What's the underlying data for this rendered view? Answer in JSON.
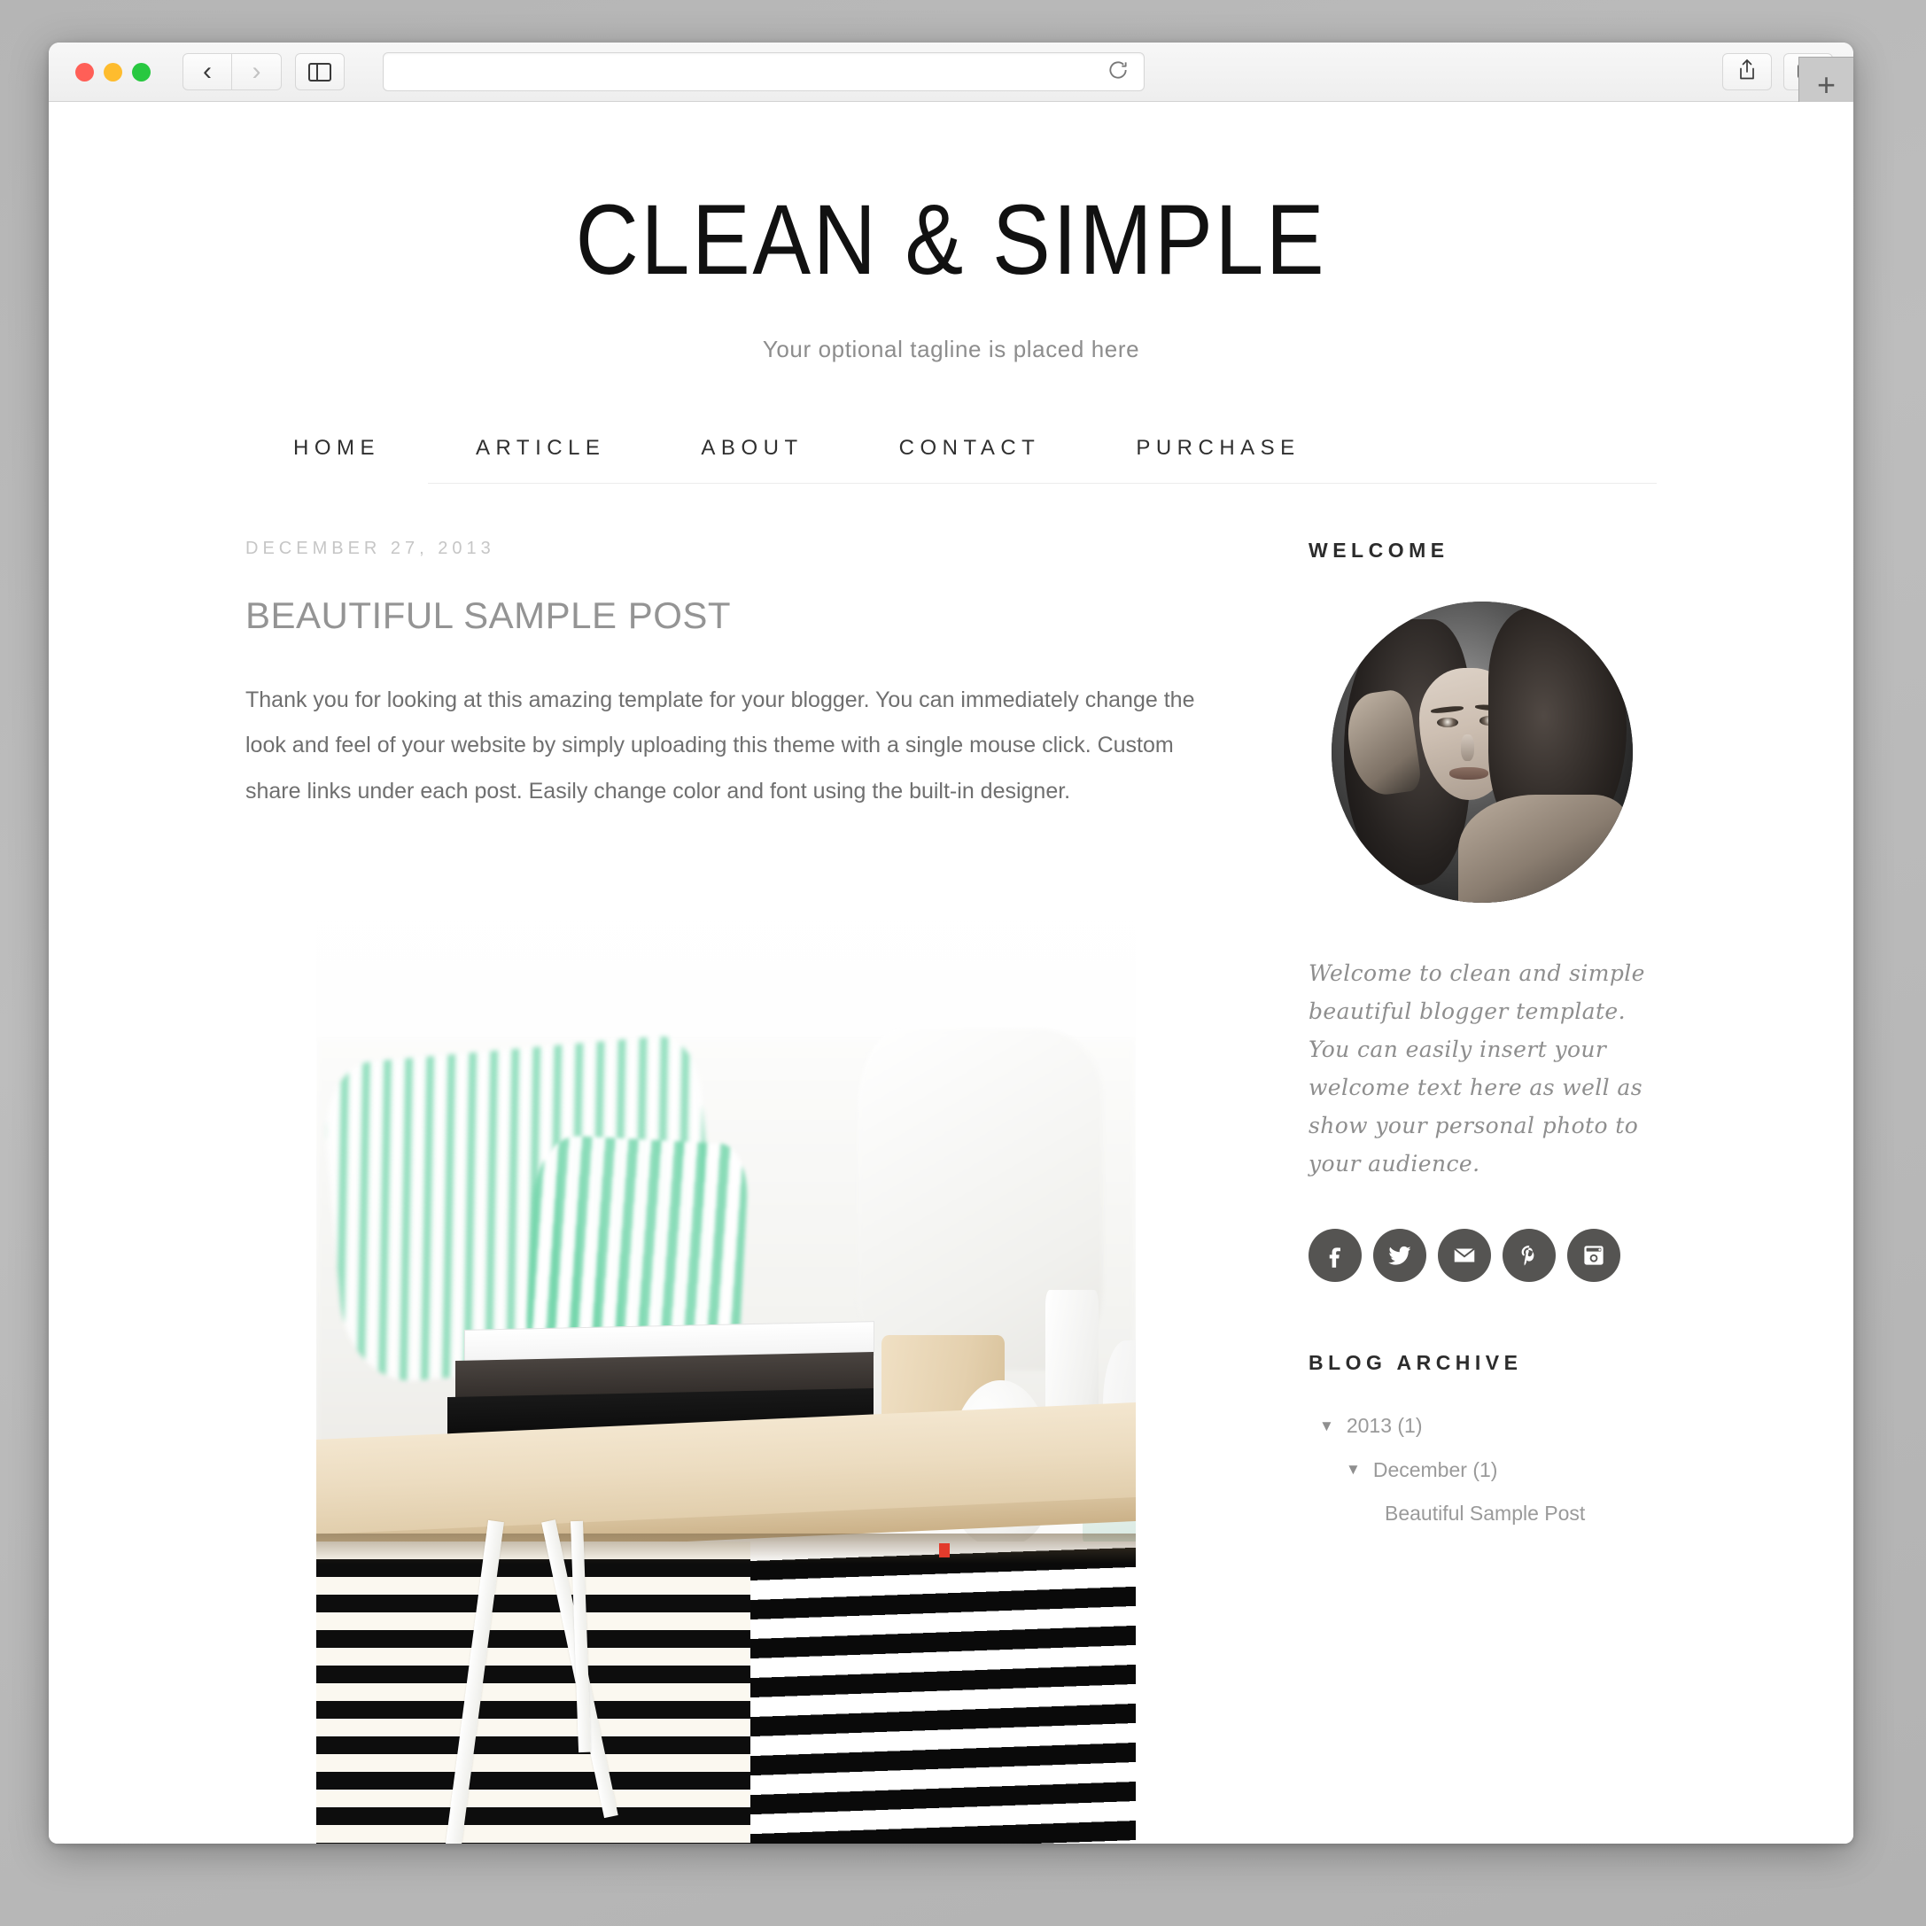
{
  "browser": {
    "traffic_lights": [
      "close",
      "minimize",
      "maximize"
    ],
    "back_label": "‹",
    "forward_label": "›",
    "sidebar_icon": "sidebar-icon",
    "url_value": "",
    "url_placeholder": "",
    "reload_icon": "reload-icon",
    "share_icon": "share-icon",
    "tabs_icon": "tab-overview-icon",
    "new_tab_label": "+"
  },
  "site": {
    "title": "CLEAN & SIMPLE",
    "tagline": "Your optional tagline is placed here",
    "nav": [
      {
        "label": "HOME",
        "active": true
      },
      {
        "label": "ARTICLE",
        "active": false
      },
      {
        "label": "ABOUT",
        "active": false
      },
      {
        "label": "CONTACT",
        "active": false
      },
      {
        "label": "PURCHASE",
        "active": false
      }
    ]
  },
  "post": {
    "date": "DECEMBER 27, 2013",
    "title": "BEAUTIFUL SAMPLE POST",
    "body": "Thank you for looking at this amazing template for your blogger. You can immediately change the look and feel of your website by simply uploading this theme with a single mouse click. Custom share links under each post. Easily change color and font using the built-in designer.",
    "image_alt": "Bright living room with mint striped pillow, wooden table with stacked books and white vases on a black and white striped rug"
  },
  "sidebar": {
    "welcome": {
      "heading": "WELCOME",
      "avatar_alt": "Black and white portrait of a woman",
      "text": "Welcome to clean and simple beautiful blogger template. You can easily insert your welcome text here as well as show your personal photo to your audience."
    },
    "social": [
      {
        "name": "facebook",
        "label": "Facebook"
      },
      {
        "name": "twitter",
        "label": "Twitter"
      },
      {
        "name": "email",
        "label": "Email"
      },
      {
        "name": "pinterest",
        "label": "Pinterest"
      },
      {
        "name": "instagram",
        "label": "Instagram"
      }
    ],
    "archive": {
      "heading": "BLOG ARCHIVE",
      "items": [
        {
          "caret": "▼",
          "label": "2013 (1)",
          "level": 0
        },
        {
          "caret": "▼",
          "label": "December (1)",
          "level": 1
        },
        {
          "caret": "",
          "label": "Beautiful Sample Post",
          "level": 2
        }
      ]
    }
  },
  "colors": {
    "accent_mint": "#7ad8b0",
    "text_dark": "#2c2c2c",
    "text_muted": "#8e8e8e",
    "social_bg": "#555452"
  }
}
